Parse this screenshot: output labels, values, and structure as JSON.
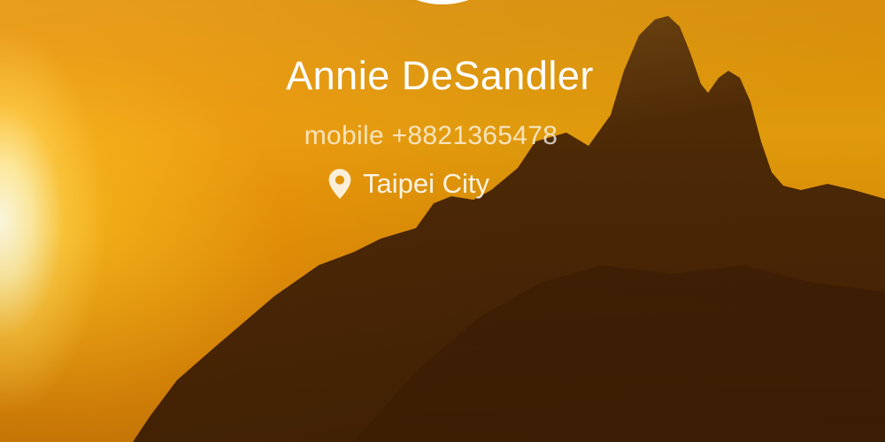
{
  "profile": {
    "name": "Annie DeSandler",
    "phone": "mobile +8821365478",
    "location": "Taipei City"
  },
  "icons": {
    "avatar": "avatar-image",
    "location": "location-pin-icon"
  },
  "colors": {
    "sky_light": "#ffe9a0",
    "sky_mid": "#d48a06",
    "mountain": "#3a1d05",
    "text": "#ffffff"
  }
}
